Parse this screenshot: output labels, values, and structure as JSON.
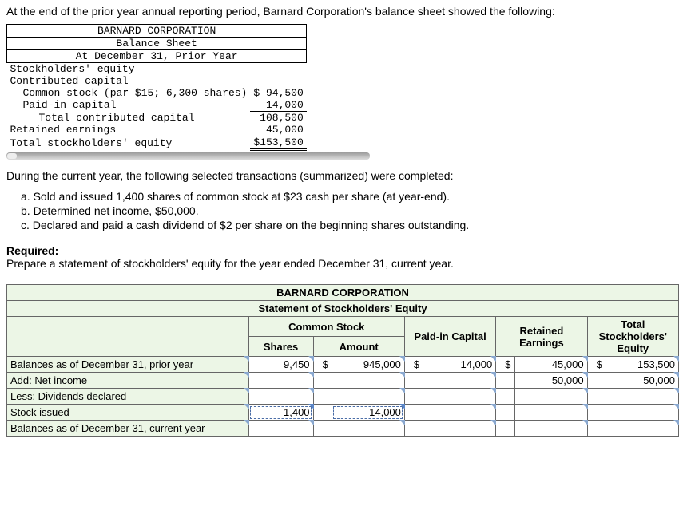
{
  "intro": "At the end of the prior year annual reporting period, Barnard Corporation's balance sheet showed the following:",
  "bs": {
    "h1": "BARNARD CORPORATION",
    "h2": "Balance Sheet",
    "h3": "At December 31, Prior Year",
    "r_se": "Stockholders' equity",
    "r_cc": "Contributed capital",
    "r_cs": "Common stock (par $15; 6,300 shares)",
    "r_pic": "Paid-in capital",
    "r_tcc": "Total contributed capital",
    "r_re": "Retained earnings",
    "r_tse": "Total stockholders' equity",
    "v_cs": "$ 94,500",
    "v_pic": "14,000",
    "v_tcc": "108,500",
    "v_re": "45,000",
    "v_tse": "$153,500"
  },
  "txn_intro": "During the current year, the following selected transactions (summarized) were completed:",
  "txn_a": "a. Sold and issued 1,400 shares of common stock at $23 cash per share (at year-end).",
  "txn_b": "b. Determined net income, $50,000.",
  "txn_c": "c. Declared and paid a cash dividend of $2 per share on the beginning shares outstanding.",
  "req_h": "Required:",
  "req_t": "Prepare a statement of stockholders' equity for the year ended December 31, current year.",
  "soe": {
    "title1": "BARNARD CORPORATION",
    "title2": "Statement of Stockholders' Equity",
    "h_cs": "Common Stock",
    "h_shares": "Shares",
    "h_amount": "Amount",
    "h_pic": "Paid-in Capital",
    "h_re": "Retained Earnings",
    "h_tse": "Total Stockholders' Equity",
    "rows": [
      {
        "label": "Balances as of December 31, prior year",
        "shares": "9,450",
        "sym_amt": "$",
        "amount": "945,000",
        "sym_pic": "$",
        "pic": "14,000",
        "sym_re": "$",
        "re": "45,000",
        "sym_tse": "$",
        "tse": "153,500"
      },
      {
        "label": "Add: Net income",
        "shares": "",
        "sym_amt": "",
        "amount": "",
        "sym_pic": "",
        "pic": "",
        "sym_re": "",
        "re": "50,000",
        "sym_tse": "",
        "tse": "50,000"
      },
      {
        "label": "Less: Dividends declared",
        "shares": "",
        "sym_amt": "",
        "amount": "",
        "sym_pic": "",
        "pic": "",
        "sym_re": "",
        "re": "",
        "sym_tse": "",
        "tse": ""
      },
      {
        "label": "Stock issued",
        "shares": "1,400",
        "sym_amt": "",
        "amount": "14,000",
        "sym_pic": "",
        "pic": "",
        "sym_re": "",
        "re": "",
        "sym_tse": "",
        "tse": ""
      },
      {
        "label": "Balances as of December 31, current year",
        "shares": "",
        "sym_amt": "",
        "amount": "",
        "sym_pic": "",
        "pic": "",
        "sym_re": "",
        "re": "",
        "sym_tse": "",
        "tse": ""
      }
    ]
  }
}
